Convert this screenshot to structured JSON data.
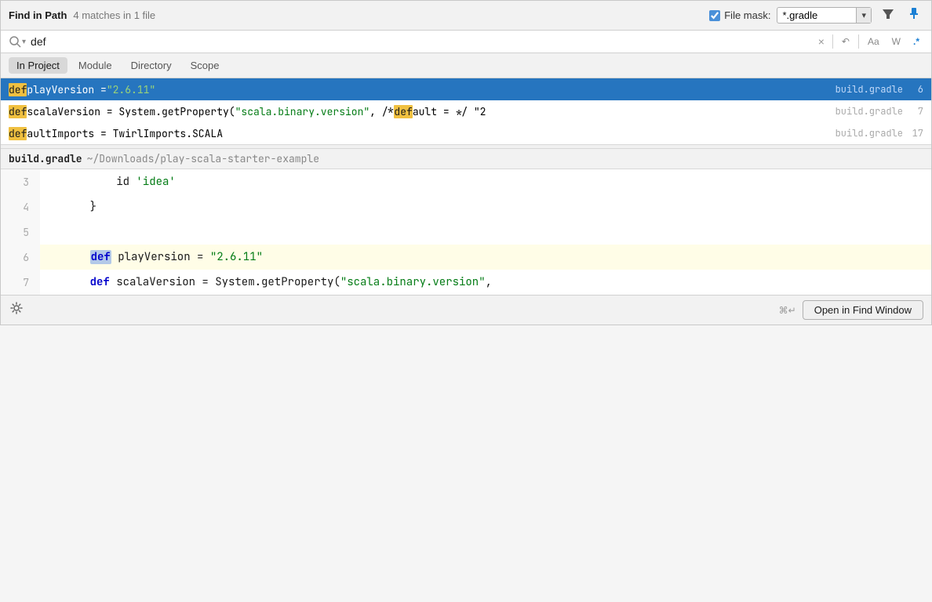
{
  "header": {
    "title": "Find in Path",
    "match_summary": "4 matches in 1 file",
    "file_mask_label": "File mask:",
    "file_mask_value": "*.gradle",
    "file_mask_checked": true,
    "filter_icon": "▼",
    "pin_icon": "📌"
  },
  "search": {
    "query": "def",
    "placeholder": "",
    "clear_label": "×",
    "restore_label": "↶",
    "case_sensitive_label": "Aa",
    "whole_word_label": "W",
    "regex_label": ".*"
  },
  "scope_tabs": {
    "items": [
      {
        "label": "In Project",
        "active": true
      },
      {
        "label": "Module",
        "active": false
      },
      {
        "label": "Directory",
        "active": false
      },
      {
        "label": "Scope",
        "active": false
      }
    ]
  },
  "results": [
    {
      "prefix": "def",
      "prefix_highlight": true,
      "text": " playVersion = \"2.6.11\"",
      "filename": "build.gradle",
      "line": "6",
      "selected": true
    },
    {
      "prefix": "def",
      "prefix_highlight": true,
      "text_parts": [
        {
          "t": " scalaVersion = System.getProperty(\"",
          "type": "plain"
        },
        {
          "t": "scala.binary.version",
          "type": "string"
        },
        {
          "t": "\", /* ",
          "type": "plain"
        },
        {
          "t": "def",
          "type": "match"
        },
        {
          "t": "ault = */ \"2",
          "type": "plain"
        }
      ],
      "filename": "build.gradle",
      "line": "7",
      "selected": false
    },
    {
      "prefix": "def",
      "prefix_highlight": true,
      "text": "aultImports = TwirlImports.SCALA",
      "filename": "build.gradle",
      "line": "17",
      "selected": false
    }
  ],
  "preview": {
    "filename": "build.gradle",
    "path": "~/Downloads/play-scala-starter-example",
    "lines": [
      {
        "num": "3",
        "content": "        id 'idea'",
        "highlighted": false,
        "has_keyword": false,
        "string": "'idea'"
      },
      {
        "num": "4",
        "content": "    }",
        "highlighted": false
      },
      {
        "num": "5",
        "content": "",
        "highlighted": false
      },
      {
        "num": "6",
        "content": "    def playVersion = \"2.6.11\"",
        "highlighted": true,
        "keyword": "def",
        "after_keyword": " playVersion = ",
        "string": "\"2.6.11\""
      },
      {
        "num": "7",
        "content": "    def scalaVersion = System.getProperty(\"scala.binary.version\",",
        "highlighted": false,
        "keyword": "def",
        "after_keyword": " scalaVersion = System.getProperty(",
        "string": "\"scala.binary.version\"",
        "trailing": ","
      }
    ]
  },
  "footer": {
    "gear_icon": "⚙",
    "shortcut": "⌘↵",
    "open_in_find_label": "Open in Find Window"
  }
}
